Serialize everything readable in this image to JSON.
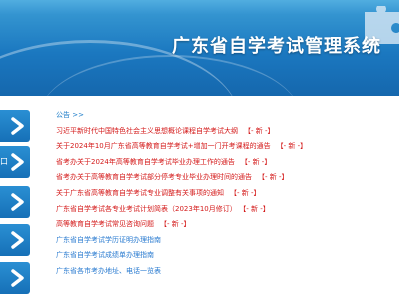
{
  "header": {
    "title": "广东省自学考试管理系统"
  },
  "sidebar": {
    "buttons": [
      {
        "label": ""
      },
      {
        "label": "口"
      },
      {
        "label": ""
      },
      {
        "label": ""
      },
      {
        "label": ""
      }
    ]
  },
  "announcements": {
    "title": "公告 >>",
    "items": [
      {
        "text": "习近平新时代中国特色社会主义思想概论课程自学考试大纲",
        "tag": "【- 新 -】",
        "color": "red"
      },
      {
        "text": "关于2024年10月广东省高等教育自学考试+增加一门开考课程的通告",
        "tag": "【- 新 -】",
        "color": "red"
      },
      {
        "text": "省考办关于2024年高等教育自学考试毕业办理工作的通告",
        "tag": "【- 新 -】",
        "color": "red"
      },
      {
        "text": "省考办关于高等教育自学考试部分停考专业毕业办理时间的通告",
        "tag": "【- 新 -】",
        "color": "red"
      },
      {
        "text": "关于广东省高等教育自学考试专业调整有关事项的通知",
        "tag": "【- 新 -】",
        "color": "red"
      },
      {
        "text": "广东省自学考试各专业考试计划简表（2023年10月修订）",
        "tag": "【- 新 -】",
        "color": "red"
      },
      {
        "text": "高等教育自学考试常见咨询问题",
        "tag": "【- 新 -】",
        "color": "red"
      },
      {
        "text": "广东省自学考试学历证明办理指南",
        "tag": "",
        "color": "blue"
      },
      {
        "text": "广东省自学考试成绩单办理指南",
        "tag": "",
        "color": "blue"
      },
      {
        "text": "广东省各市考办地址、电话一览表",
        "tag": "",
        "color": "blue"
      }
    ]
  },
  "colors": {
    "banner": "#1b78c0",
    "link_red": "#d41a1a",
    "link_blue": "#2a7bd0",
    "nav_button": "#1670b7"
  },
  "icons": {
    "banner_corner": "puzzle-icon",
    "nav_arrow": "chevron-right-icon"
  }
}
